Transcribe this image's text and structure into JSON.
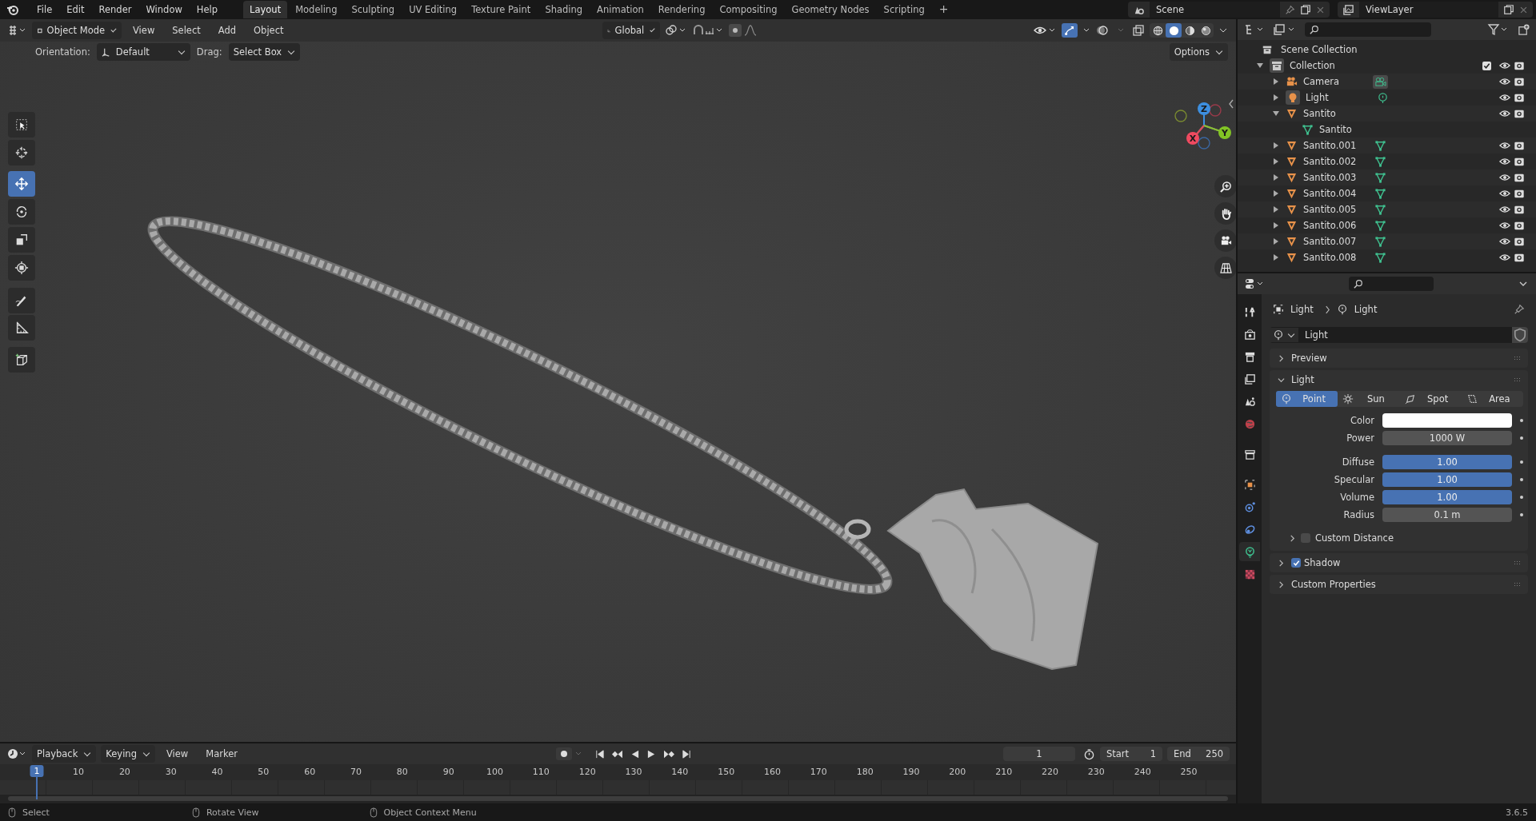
{
  "menu": [
    "File",
    "Edit",
    "Render",
    "Window",
    "Help"
  ],
  "workspace_tabs": [
    {
      "label": "Layout",
      "selected": true
    },
    {
      "label": "Modeling",
      "selected": false
    },
    {
      "label": "Sculpting",
      "selected": false
    },
    {
      "label": "UV Editing",
      "selected": false
    },
    {
      "label": "Texture Paint",
      "selected": false
    },
    {
      "label": "Shading",
      "selected": false
    },
    {
      "label": "Animation",
      "selected": false
    },
    {
      "label": "Rendering",
      "selected": false
    },
    {
      "label": "Compositing",
      "selected": false
    },
    {
      "label": "Geometry Nodes",
      "selected": false
    },
    {
      "label": "Scripting",
      "selected": false
    }
  ],
  "add_workspace": "+",
  "scene": "Scene",
  "view_layer": "ViewLayer",
  "viewport_header": {
    "mode": "Object Mode",
    "menus": [
      "View",
      "Select",
      "Add",
      "Object"
    ],
    "transform_orientation": "Global",
    "show_gizmo": true,
    "shading": [
      {
        "kind": "wireframe",
        "selected": false
      },
      {
        "kind": "solid",
        "selected": true
      },
      {
        "kind": "material",
        "selected": false
      },
      {
        "kind": "rendered",
        "selected": false
      }
    ]
  },
  "tool_settings": {
    "orientation_label": "Orientation:",
    "orientation": "Default",
    "drag_label": "Drag:",
    "drag": "Select Box",
    "options": "Options"
  },
  "tools": [
    {
      "kind": "select",
      "selected": false
    },
    {
      "kind": "cursor",
      "selected": false
    },
    {
      "kind": "move",
      "selected": true
    },
    {
      "kind": "rotate",
      "selected": false
    },
    {
      "kind": "scale",
      "selected": false
    },
    {
      "kind": "transform",
      "selected": false
    },
    {
      "kind": "annotate",
      "selected": false
    },
    {
      "kind": "measure",
      "selected": false
    },
    {
      "kind": "add-cube",
      "selected": false
    }
  ],
  "navigation_gizmo": {
    "x": "X",
    "y": "Y",
    "z": "Z"
  },
  "outliner": {
    "root": "Scene Collection",
    "items": [
      {
        "name": "Collection",
        "kind": "collection",
        "expanded": true,
        "checked": true,
        "children": [
          {
            "name": "Camera",
            "kind": "camera",
            "expanded": false
          },
          {
            "name": "Light",
            "kind": "light",
            "expanded": false
          },
          {
            "name": "Santito",
            "kind": "mesh",
            "expanded": true,
            "children": [
              {
                "name": "Santito",
                "kind": "mesh-data"
              }
            ]
          },
          {
            "name": "Santito.001",
            "kind": "mesh",
            "expanded": false
          },
          {
            "name": "Santito.002",
            "kind": "mesh",
            "expanded": false
          },
          {
            "name": "Santito.003",
            "kind": "mesh",
            "expanded": false
          },
          {
            "name": "Santito.004",
            "kind": "mesh",
            "expanded": false
          },
          {
            "name": "Santito.005",
            "kind": "mesh",
            "expanded": false
          },
          {
            "name": "Santito.006",
            "kind": "mesh",
            "expanded": false
          },
          {
            "name": "Santito.007",
            "kind": "mesh",
            "expanded": false
          },
          {
            "name": "Santito.008",
            "kind": "mesh",
            "expanded": false
          }
        ]
      }
    ]
  },
  "properties": {
    "tabs": [
      {
        "kind": "tool",
        "selected": false
      },
      {
        "kind": "render",
        "selected": false
      },
      {
        "kind": "output",
        "selected": false
      },
      {
        "kind": "view-layer",
        "selected": false
      },
      {
        "kind": "scene",
        "selected": false
      },
      {
        "kind": "world",
        "selected": false
      },
      {
        "kind": "collection",
        "selected": false
      },
      {
        "kind": "object",
        "selected": false
      },
      {
        "kind": "physics",
        "selected": false
      },
      {
        "kind": "constraints",
        "selected": false
      },
      {
        "kind": "data",
        "selected": true
      },
      {
        "kind": "texture",
        "selected": false
      }
    ],
    "breadcrumb": [
      "Light",
      "Light"
    ],
    "datablock": "Light",
    "preview": {
      "title": "Preview",
      "expanded": false
    },
    "light": {
      "title": "Light",
      "expanded": true,
      "types": [
        {
          "label": "Point",
          "selected": true
        },
        {
          "label": "Sun",
          "selected": false
        },
        {
          "label": "Spot",
          "selected": false
        },
        {
          "label": "Area",
          "selected": false
        }
      ],
      "fields": [
        {
          "kind": "color",
          "label": "Color",
          "color": "#ffffff"
        },
        {
          "kind": "number",
          "label": "Power",
          "value": "1000 W"
        },
        {
          "kind": "slider",
          "label": "Diffuse",
          "value": "1.00",
          "level": 1
        },
        {
          "kind": "slider",
          "label": "Specular",
          "value": "1.00",
          "level": 1
        },
        {
          "kind": "slider",
          "label": "Volume",
          "value": "1.00",
          "level": 1
        },
        {
          "kind": "number",
          "label": "Radius",
          "value": "0.1 m"
        }
      ],
      "custom_distance": {
        "label": "Custom Distance",
        "checked": false
      }
    },
    "shadow": {
      "title": "Shadow",
      "checked": true,
      "expanded": false
    },
    "custom_properties": {
      "title": "Custom Properties",
      "expanded": false
    }
  },
  "timeline": {
    "menus": [
      "Playback",
      "Keying",
      "View",
      "Marker"
    ],
    "current_frame": "1",
    "start_label": "Start",
    "start": "1",
    "end_label": "End",
    "end": "250",
    "playhead": "1",
    "ruler": [
      "10",
      "20",
      "30",
      "40",
      "50",
      "60",
      "70",
      "80",
      "90",
      "100",
      "110",
      "120",
      "130",
      "140",
      "150",
      "160",
      "170",
      "180",
      "190",
      "200",
      "210",
      "220",
      "230",
      "240",
      "250"
    ]
  },
  "status_bar": [
    "Select",
    "Rotate View",
    "Object Context Menu"
  ],
  "version": "3.6.5"
}
